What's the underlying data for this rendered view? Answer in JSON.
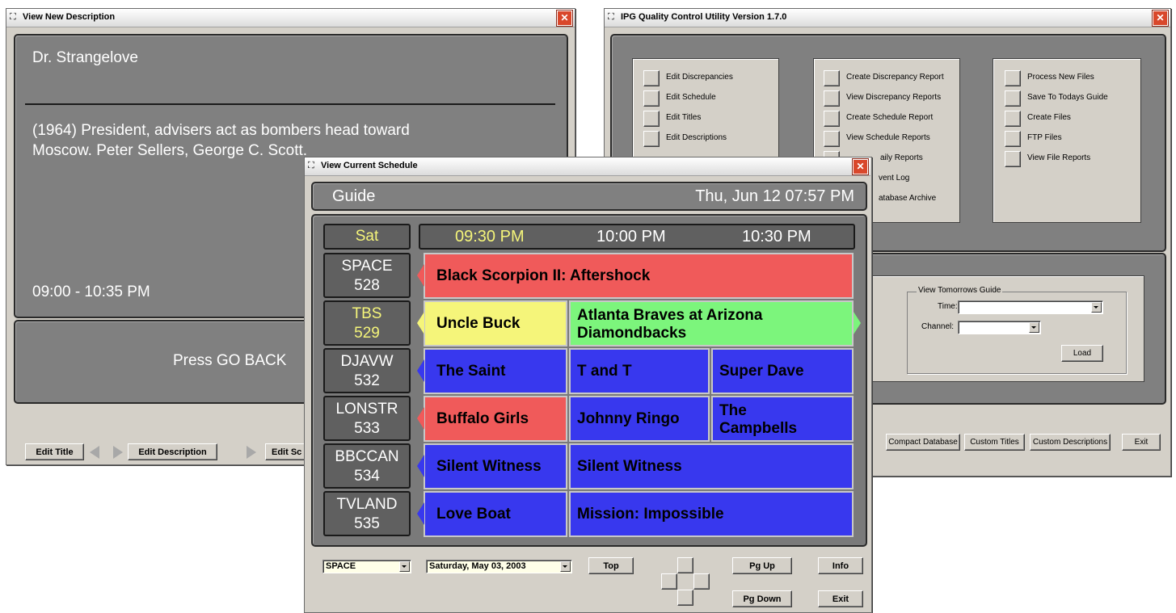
{
  "desc_window": {
    "title": "View New Description",
    "program_title": "Dr. Strangelove",
    "description_line1": "(1964) President, advisers act as bombers head toward",
    "description_line2": "Moscow. Peter Sellers, George C. Scott.",
    "time_range": "09:00 - 10:35 PM",
    "message": "Press GO BACK",
    "buttons": {
      "edit_title": "Edit Title",
      "edit_description": "Edit Description",
      "edit_schedule": "Edit Sc"
    }
  },
  "qc_window": {
    "title": "IPG Quality Control Utility Version 1.7.0",
    "col1": [
      "Edit Discrepancies",
      "Edit Schedule",
      "Edit Titles",
      "Edit Descriptions"
    ],
    "col2": [
      "Create Discrepancy Report",
      "View Discrepancy Reports",
      "Create Schedule Report",
      "View Schedule Reports",
      "aily Reports",
      "vent Log",
      "atabase Archive"
    ],
    "col3": [
      "Process New Files",
      "Save To Todays Guide",
      "Create Files",
      "FTP Files",
      "View File Reports"
    ],
    "tomorrow": {
      "group_label": "View Tomorrows Guide",
      "time_label": "Time:",
      "channel_label": "Channel:",
      "load": "Load"
    },
    "bottom_buttons": {
      "compact": "Compact Database",
      "custom_titles": "Custom Titles",
      "custom_descriptions": "Custom Descriptions",
      "exit": "Exit"
    }
  },
  "schedule_window": {
    "title": "View Current Schedule",
    "header_left": "Guide",
    "header_right": "Thu, Jun 12 07:57 PM",
    "day": "Sat",
    "times": [
      "09:30 PM",
      "10:00 PM",
      "10:30 PM"
    ],
    "channels": [
      {
        "name": "SPACE",
        "number": "528"
      },
      {
        "name": "TBS",
        "number": "529"
      },
      {
        "name": "DJAVW",
        "number": "532"
      },
      {
        "name": "LONSTR",
        "number": "533"
      },
      {
        "name": "BBCCAN",
        "number": "534"
      },
      {
        "name": "TVLAND",
        "number": "535"
      }
    ],
    "programs": {
      "space": [
        "Black Scorpion II: Aftershock"
      ],
      "tbs": [
        "Uncle Buck",
        "Atlanta Braves at Arizona",
        "Diamondbacks"
      ],
      "djavw": [
        "The Saint",
        "T and T",
        "Super Dave"
      ],
      "lonstr": [
        "Buffalo Girls",
        "Johnny Ringo",
        "The",
        "Campbells"
      ],
      "bbccan": [
        "Silent Witness",
        "Silent Witness"
      ],
      "tvland": [
        "Love Boat",
        "Mission: Impossible"
      ]
    },
    "channel_select": "SPACE",
    "date_select": "Saturday, May 03, 2003",
    "buttons": {
      "top": "Top",
      "pg_up": "Pg Up",
      "pg_down": "Pg Down",
      "info": "Info",
      "exit": "Exit"
    }
  },
  "colors": {
    "red": "#f05a5a",
    "yellow": "#f5f57a",
    "green": "#7cf57c",
    "blue": "#3838ee",
    "highlight_text": "#f5f57a"
  }
}
